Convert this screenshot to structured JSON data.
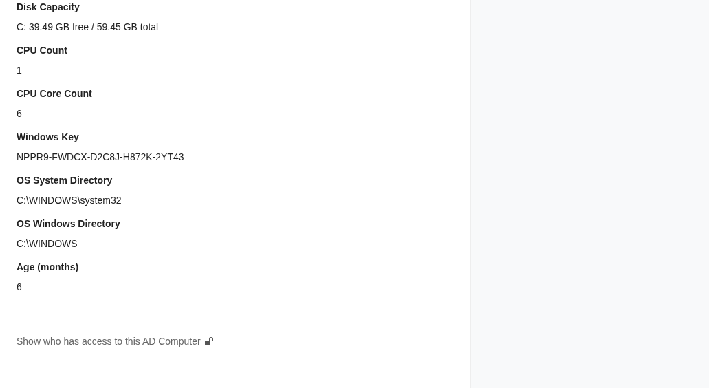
{
  "fields": [
    {
      "label": "Disk Capacity",
      "value": "C: 39.49 GB free / 59.45 GB total"
    },
    {
      "label": "CPU Count",
      "value": "1"
    },
    {
      "label": "CPU Core Count",
      "value": "6"
    },
    {
      "label": "Windows Key",
      "value": "NPPR9-FWDCX-D2C8J-H872K-2YT43"
    },
    {
      "label": "OS System Directory",
      "value": "C:\\WINDOWS\\system32"
    },
    {
      "label": "OS Windows Directory",
      "value": "C:\\WINDOWS"
    },
    {
      "label": "Age (months)",
      "value": "6"
    }
  ],
  "access_link": {
    "label": "Show who has access to this AD Computer"
  }
}
